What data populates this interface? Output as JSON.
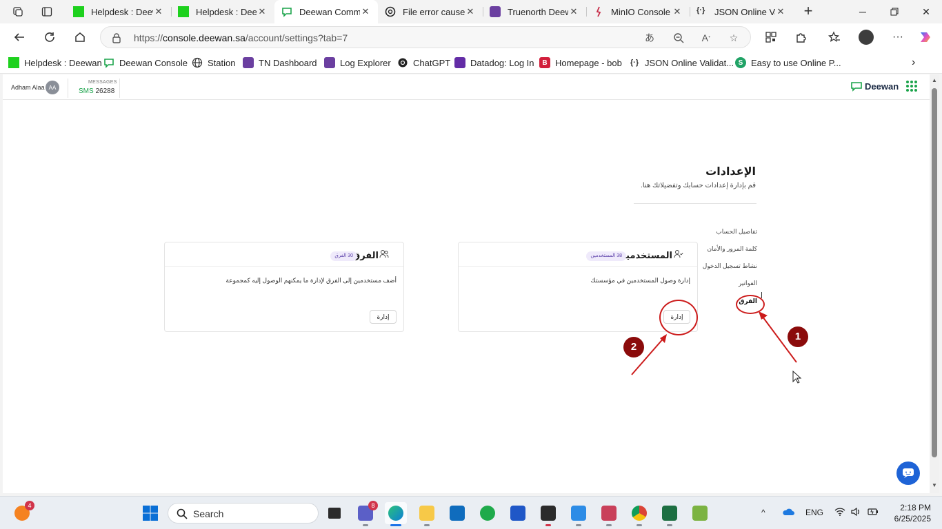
{
  "tabs": [
    {
      "title": "Helpdesk : Deewan",
      "icon": "green-square-icon",
      "active": false
    },
    {
      "title": "Helpdesk : Deewan",
      "icon": "green-square-icon",
      "active": false
    },
    {
      "title": "Deewan Communications",
      "icon": "deewan-chat-icon",
      "active": true
    },
    {
      "title": "File error cause",
      "icon": "chatgpt-icon",
      "active": false
    },
    {
      "title": "Truenorth Deewan",
      "icon": "truenorth-icon",
      "active": false
    },
    {
      "title": "MinIO Console",
      "icon": "minio-icon",
      "active": false
    },
    {
      "title": "JSON Online Validator",
      "icon": "json-icon",
      "active": false
    }
  ],
  "address": {
    "url_prefix": "https://",
    "url_host": "console.deewan.sa",
    "url_path": "/account/settings?tab=7"
  },
  "bookmarks": [
    {
      "label": "Helpdesk : Deewan",
      "icon": "green-square-icon"
    },
    {
      "label": "Deewan Console",
      "icon": "deewan-chat-icon"
    },
    {
      "label": "Station",
      "icon": "globe-icon"
    },
    {
      "label": "TN Dashboard",
      "icon": "truenorth-icon"
    },
    {
      "label": "Log Explorer",
      "icon": "truenorth-icon"
    },
    {
      "label": "ChatGPT",
      "icon": "chatgpt-icon"
    },
    {
      "label": "Datadog: Log In",
      "icon": "datadog-icon"
    },
    {
      "label": "Homepage - bob",
      "icon": "b-icon",
      "glyph": "B"
    },
    {
      "label": "JSON Online Validat...",
      "icon": "json-icon"
    },
    {
      "label": "Easy to use Online P...",
      "icon": "s-icon",
      "glyph": "S"
    }
  ],
  "header": {
    "user_name": "Adham Alaa",
    "user_initials": "AA",
    "messages_label": "MESSAGES",
    "sms_label": "SMS",
    "sms_count": "26288",
    "brand": "Deewan"
  },
  "settings": {
    "title": "الإعدادات",
    "subtitle": "قم بإدارة إعدادات حسابك وتفضيلاتك هنا.",
    "nav": [
      {
        "label": "تفاصيل الحساب",
        "active": false
      },
      {
        "label": "كلمة المرور والأمان",
        "active": false
      },
      {
        "label": "نشاط تسجيل الدخول",
        "active": false
      },
      {
        "label": "الفواتير",
        "active": false
      },
      {
        "label": "الفرق",
        "active": true
      }
    ]
  },
  "cards": {
    "users": {
      "title": "المستخدمين",
      "badge": "38 المستخدمين",
      "description": "إدارة وصول المستخدمين في مؤسستك",
      "button": "إدارة"
    },
    "teams": {
      "title": "الفرق",
      "badge": "30 الفرق",
      "description": "أضف مستخدمين إلى الفرق لإدارة ما يمكنهم الوصول إليه كمجموعة",
      "button": "إدارة"
    }
  },
  "annotations": {
    "step1": "1",
    "step2": "2",
    "color": "#cc1b1b"
  },
  "taskbar": {
    "search_placeholder": "Search",
    "notification_count": "4",
    "teams_badge": "8",
    "language": "ENG",
    "time": "2:18 PM",
    "date": "6/25/2025"
  }
}
